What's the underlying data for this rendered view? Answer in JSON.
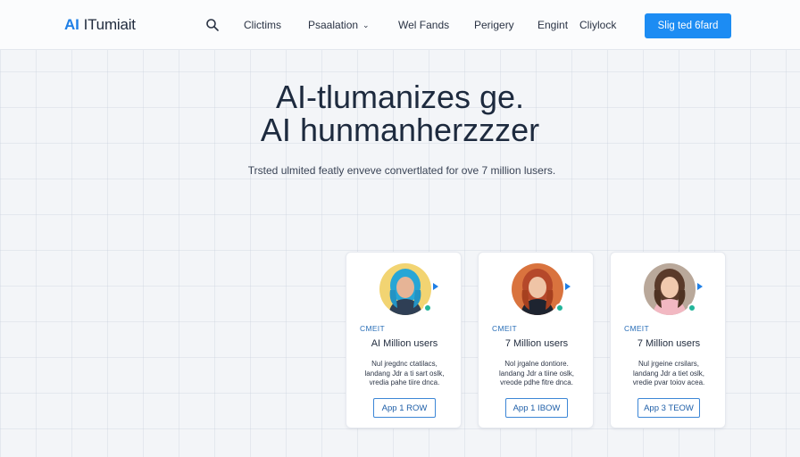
{
  "header": {
    "logo_ai": "AI",
    "logo_name": "ITumiait",
    "nav": [
      {
        "label": "Clictims"
      },
      {
        "label": "Psaalation",
        "has_dropdown": true
      },
      {
        "label": "Wel Fands"
      },
      {
        "label": "Perigery"
      },
      {
        "label": "Engint"
      },
      {
        "label": "Cliylock"
      }
    ],
    "cta_label": "Slig ted 6fard"
  },
  "hero": {
    "title_line1": "AI-tlumanizes ge.",
    "title_line2": "AI hunmanherzzzer",
    "subtitle": "Trsted ulmited featly enveve convertlated for ove 7 million lusers."
  },
  "cards": [
    {
      "tag": "CMEIT",
      "title": "AI Million users",
      "desc_lines": [
        "Nul jregdnc ctatilacs,",
        "landang Jdr a ti sart oslk,",
        "vredia pahe tiire dnca."
      ],
      "button": "App 1 ROW"
    },
    {
      "tag": "CMEIT",
      "title": "7 Million users",
      "desc_lines": [
        "Nol jrgalne dontiore.",
        "landang Jdr a tiine oslk,",
        "vreode pdhe fitre dnca."
      ],
      "button": "App 1 IBOW"
    },
    {
      "tag": "CMEIT",
      "title": "7 Million users",
      "desc_lines": [
        "Nul jrgeine crsilars,",
        "landang Jdr a tiet oslk,",
        "vredie pvar toiov acea."
      ],
      "button": "App 3 TEOW"
    }
  ],
  "colors": {
    "accent": "#1c8cf3",
    "status_online": "#22b59a"
  },
  "icons": [
    "search-icon",
    "chevron-down-icon",
    "play-icon",
    "status-dot"
  ]
}
